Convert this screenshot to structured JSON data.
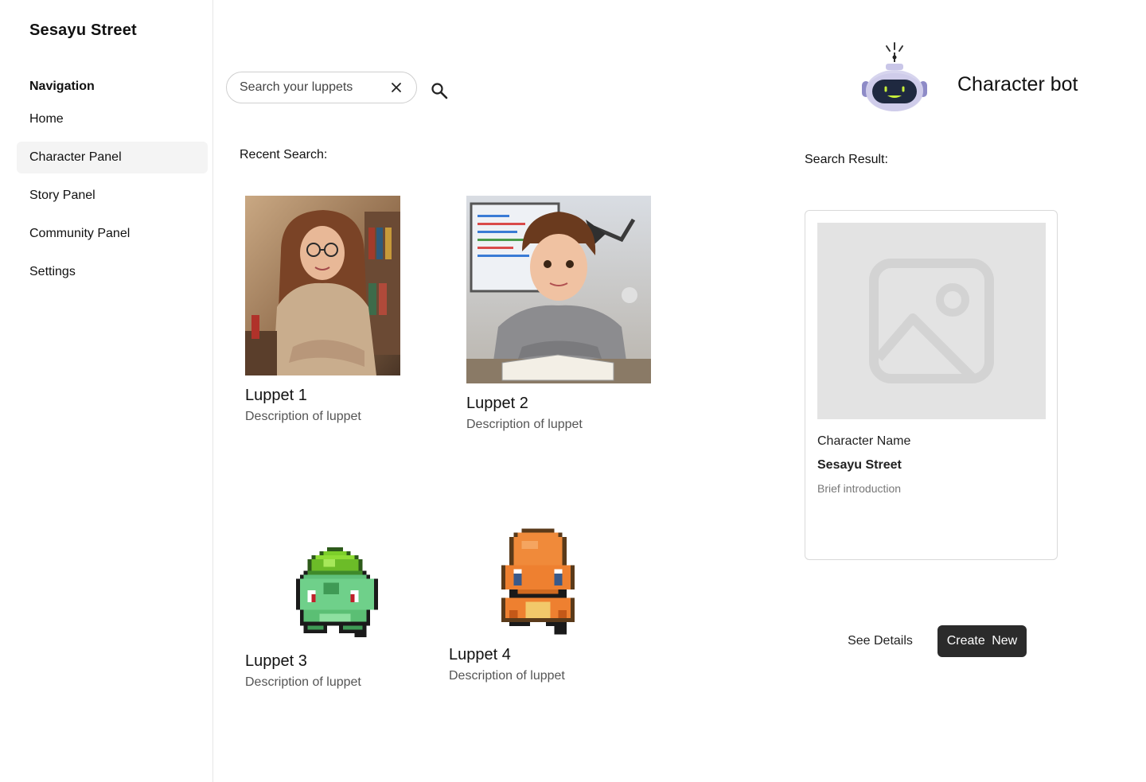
{
  "app": {
    "brand": "Sesayu Street"
  },
  "sidebar": {
    "heading": "Navigation",
    "items": [
      {
        "label": "Home",
        "active": false
      },
      {
        "label": "Character Panel",
        "active": true
      },
      {
        "label": "Story Panel",
        "active": false
      },
      {
        "label": "Community Panel",
        "active": false
      },
      {
        "label": "Settings",
        "active": false
      }
    ]
  },
  "search": {
    "placeholder": "Search your luppets",
    "value": ""
  },
  "recent": {
    "label": "Recent Search:",
    "items": [
      {
        "name": "Luppet 1",
        "description": "Description of luppet",
        "image": "woman-with-glasses-portrait"
      },
      {
        "name": "Luppet 2",
        "description": "Description of luppet",
        "image": "boy-at-desk-portrait"
      },
      {
        "name": "Luppet 3",
        "description": "Description of luppet",
        "image": "green-pixel-creature"
      },
      {
        "name": "Luppet 4",
        "description": "Description of luppet",
        "image": "orange-pixel-creature"
      }
    ]
  },
  "bot": {
    "title": "Character bot",
    "icon": "robot-icon"
  },
  "result": {
    "label": "Search Result:",
    "field_label": "Character Name",
    "name": "Sesayu Street",
    "intro": "Brief introduction"
  },
  "actions": {
    "details": "See Details",
    "create": "Create  New"
  },
  "colors": {
    "primary_button": "#2b2b2b",
    "active_nav": "#f4f4f4",
    "placeholder_bg": "#e3e3e3"
  }
}
